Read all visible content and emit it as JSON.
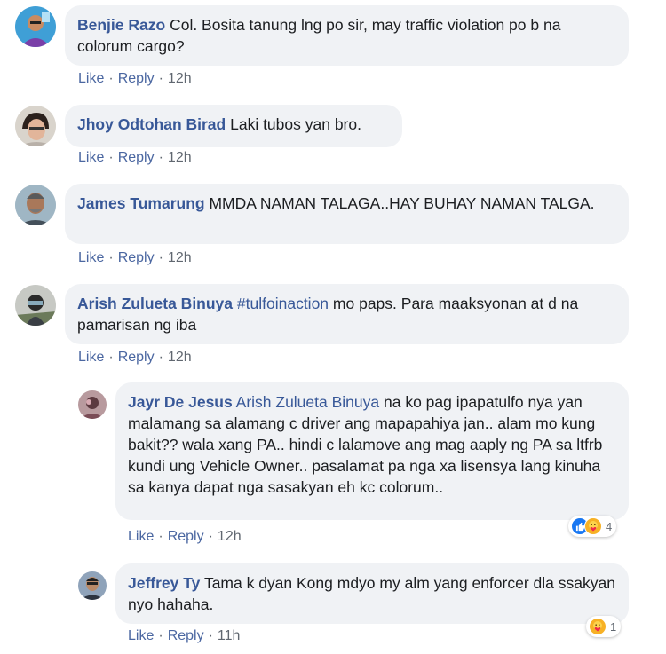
{
  "comments": [
    {
      "author": "Benjie Razo",
      "text": "Col. Bosita tanung lng po sir, may traffic violation po b na colorum cargo?",
      "actions": {
        "like": "Like",
        "reply": "Reply",
        "time": "12h"
      }
    },
    {
      "author": "Jhoy Odtohan Birad",
      "text": "Laki tubos yan bro.",
      "actions": {
        "like": "Like",
        "reply": "Reply",
        "time": "12h"
      }
    },
    {
      "author": "James Tumarung",
      "text": "MMDA NAMAN TALAGA..HAY BUHAY NAMAN TALGA.",
      "actions": {
        "like": "Like",
        "reply": "Reply",
        "time": "12h"
      }
    },
    {
      "author": "Arish Zulueta Binuya",
      "tag": "#tulfoinaction",
      "text": "mo paps. Para maaksyonan at d na pamarisan ng iba",
      "actions": {
        "like": "Like",
        "reply": "Reply",
        "time": "12h"
      }
    }
  ],
  "replies": [
    {
      "author": "Jayr De Jesus",
      "mention": "Arish Zulueta Binuya",
      "text": "na ko pag ipapatulfo nya yan malamang sa alamang c driver ang mapapahiya jan.. alam mo kung bakit?? wala xang PA.. hindi c lalamove ang mag aaply ng PA sa ltfrb kundi ung Vehicle Owner.. pasalamat pa nga xa lisensya lang kinuha sa kanya dapat nga sasakyan eh kc colorum..",
      "actions": {
        "like": "Like",
        "reply": "Reply",
        "time": "12h"
      },
      "reactions": {
        "icons": [
          "like-icon",
          "care-icon"
        ],
        "count": "4",
        "colors": {
          "like": "#1877f2",
          "care": "#f7b125"
        }
      }
    },
    {
      "author": "Jeffrey Ty",
      "text": "Tama k dyan Kong mdyo my alm yang enforcer dla ssakyan nyo hahaha.",
      "actions": {
        "like": "Like",
        "reply": "Reply",
        "time": "11h"
      },
      "reactions": {
        "icons": [
          "care-icon"
        ],
        "count": "1",
        "colors": {
          "care": "#f7b125"
        }
      }
    }
  ],
  "colors": {
    "name": "#385898",
    "bubble": "#f0f2f5",
    "action": "#4b67a1",
    "time": "#606770",
    "text": "#1c1e21"
  }
}
